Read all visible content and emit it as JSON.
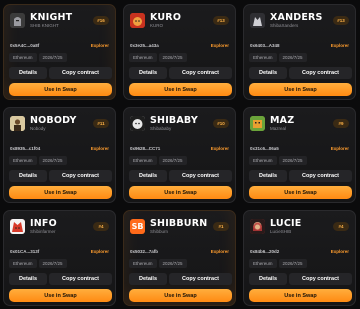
{
  "labels": {
    "explorer": "Explorer",
    "details": "Details",
    "copy_contract": "Copy contract",
    "use_in_swap": "Use in Swap"
  },
  "cards": [
    {
      "name": "KNIGHT",
      "subtitle": "SHIB KNIGHT",
      "rank": "#16",
      "address": "0x5A4C...0a8f",
      "chain": "Ethereum",
      "date": "2026/7/25",
      "avatar_icon": "knight-icon",
      "avatar_color": "#3b3b3b"
    },
    {
      "name": "KURO",
      "subtitle": "KURO",
      "rank": "#13",
      "address": "0x3e25...a43a",
      "chain": "Ethereum",
      "date": "2026/7/25",
      "avatar_icon": "red-dog-icon",
      "avatar_color": "#c8321f"
    },
    {
      "name": "XANDERS",
      "subtitle": "ShibaXanders",
      "rank": "#13",
      "address": "0x6403...A348",
      "chain": "Ethereum",
      "date": "2026/7/25",
      "avatar_icon": "wolf-icon",
      "avatar_color": "#2f2f33"
    },
    {
      "name": "NOBODY",
      "subtitle": "Nobody",
      "rank": "#11",
      "address": "0x8935...c1f04",
      "chain": "Ethereum",
      "date": "2026/7/25",
      "avatar_icon": "portrait-icon",
      "avatar_color": "#d9c9a0"
    },
    {
      "name": "SHIBABY",
      "subtitle": "Shibababy",
      "rank": "#10",
      "address": "0x9628...CC71",
      "chain": "Ethereum",
      "date": "2026/7/25",
      "avatar_icon": "baby-shiba-icon",
      "avatar_color": "#e8e8e8"
    },
    {
      "name": "MAZ",
      "subtitle": "Mazreal",
      "rank": "#9",
      "address": "0x31c6...06a5",
      "chain": "Ethereum",
      "date": "2026/7/25",
      "avatar_icon": "pixel-dog-icon",
      "avatar_color": "#6ba33a"
    },
    {
      "name": "INFO",
      "subtitle": "Shibinfarmer",
      "rank": "#4",
      "address": "0x01CA...313f",
      "chain": "Ethereum",
      "date": "2026/7/25",
      "avatar_icon": "red-shiba-icon",
      "avatar_color": "#d83a2a"
    },
    {
      "name": "SHIBBURN",
      "subtitle": "Shibburn",
      "rank": "#1",
      "address": "0x5032...7afb",
      "chain": "Ethereum",
      "date": "2026/7/25",
      "avatar_icon": "sb-logo-icon",
      "avatar_color": "#ff6a1a",
      "avatar_text": "SB"
    },
    {
      "name": "LUCIE",
      "subtitle": "LucieSHIB",
      "rank": "#4",
      "address": "0x84b6...20d2",
      "chain": "Ethereum",
      "date": "2026/7/25",
      "avatar_icon": "lucie-icon",
      "avatar_color": "#b83a3a"
    }
  ]
}
